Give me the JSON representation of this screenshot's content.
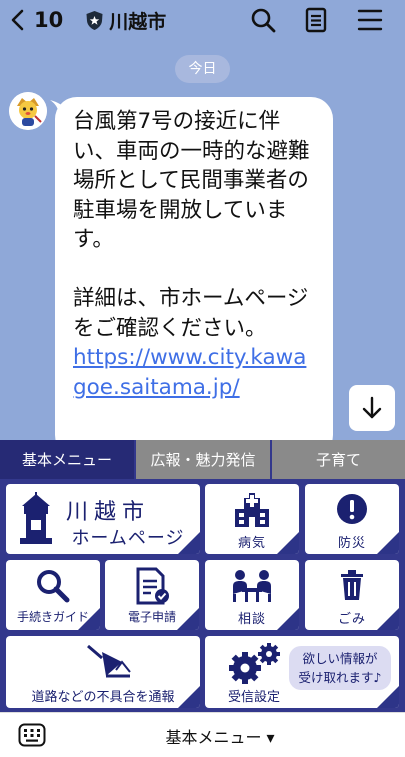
{
  "header": {
    "back_count": "10",
    "account_name": "川越市",
    "icons": [
      "chevron-left-icon",
      "shield-badge-icon",
      "search-icon",
      "notes-icon",
      "menu-icon"
    ]
  },
  "chat": {
    "date_label": "今日",
    "message_text": "台風第7号の接近に伴い、車両の一時的な避難場所として民間事業者の駐車場を開放しています。",
    "message_detail": "詳細は、市ホームページをご確認ください。",
    "message_link": "https://www.city.kawagoe.saitama.jp/"
  },
  "richmenu": {
    "tabs": [
      "基本メニュー",
      "広報・魅力発信",
      "子育て"
    ],
    "active_tab": "基本メニュー",
    "tiles": {
      "homepage_line1": "川越市",
      "homepage_line2": "ホームページ",
      "illness": "病気",
      "disaster": "防災",
      "procedure_guide": "手続きガイド",
      "e_application": "電子申請",
      "consultation": "相談",
      "garbage": "ごみ",
      "road_report": "道路などの不具合を通報",
      "receive_settings": "受信設定",
      "receive_bubble_line1": "欲しい情報が",
      "receive_bubble_line2": "受け取れます♪"
    }
  },
  "bottombar": {
    "menu_label": "基本メニュー ▾"
  },
  "colors": {
    "chat_background": "#8fa8d8",
    "menu_navy": "#33388c",
    "link_blue": "#3f6fe6"
  }
}
